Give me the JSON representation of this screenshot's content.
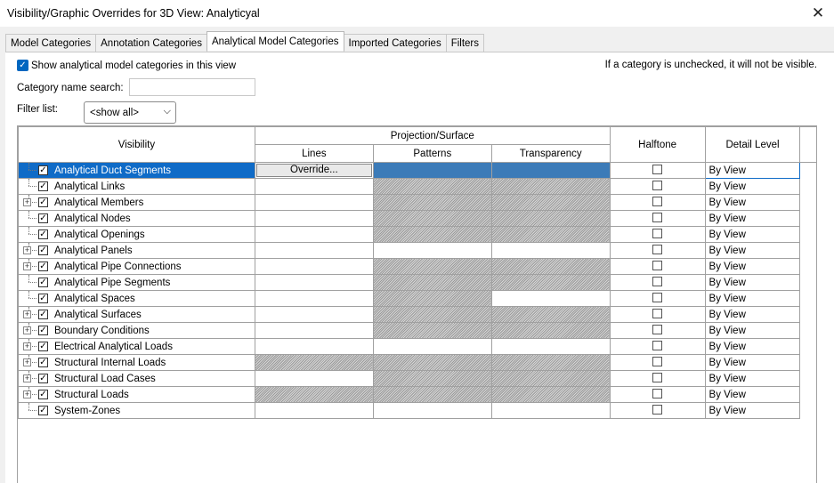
{
  "window": {
    "title": "Visibility/Graphic Overrides for 3D View: Analyticyal"
  },
  "tabs": [
    "Model Categories",
    "Annotation Categories",
    "Analytical Model Categories",
    "Imported Categories",
    "Filters"
  ],
  "active_tab": "Analytical Model Categories",
  "show_categories": {
    "label": "Show analytical model categories in this view",
    "checked": true
  },
  "note": "If a category is unchecked, it will not be visible.",
  "search": {
    "label": "Category name search:",
    "value": ""
  },
  "filter": {
    "label": "Filter list:",
    "value": "<show all>"
  },
  "grid": {
    "headers": {
      "visibility": "Visibility",
      "projection": "Projection/Surface",
      "lines": "Lines",
      "patterns": "Patterns",
      "transparency": "Transparency",
      "halftone": "Halftone",
      "detail": "Detail Level"
    },
    "override_label": "Override...",
    "rows": [
      {
        "name": "Analytical Duct Segments",
        "expandable": false,
        "lines": "override",
        "patterns": "plain",
        "transparency": "plain",
        "detail": "By View",
        "selected": true
      },
      {
        "name": "Analytical Links",
        "expandable": false,
        "lines": "plain",
        "patterns": "hatch",
        "transparency": "hatch",
        "detail": "By View"
      },
      {
        "name": "Analytical Members",
        "expandable": true,
        "lines": "plain",
        "patterns": "hatch",
        "transparency": "hatch",
        "detail": "By View"
      },
      {
        "name": "Analytical Nodes",
        "expandable": false,
        "lines": "plain",
        "patterns": "hatch",
        "transparency": "hatch",
        "detail": "By View"
      },
      {
        "name": "Analytical Openings",
        "expandable": false,
        "lines": "plain",
        "patterns": "hatch",
        "transparency": "hatch",
        "detail": "By View"
      },
      {
        "name": "Analytical Panels",
        "expandable": true,
        "lines": "plain",
        "patterns": "plain",
        "transparency": "plain",
        "detail": "By View"
      },
      {
        "name": "Analytical Pipe Connections",
        "expandable": true,
        "lines": "plain",
        "patterns": "hatch",
        "transparency": "hatch",
        "detail": "By View"
      },
      {
        "name": "Analytical Pipe Segments",
        "expandable": false,
        "lines": "plain",
        "patterns": "hatch",
        "transparency": "hatch",
        "detail": "By View"
      },
      {
        "name": "Analytical Spaces",
        "expandable": false,
        "lines": "plain",
        "patterns": "hatch",
        "transparency": "plain",
        "detail": "By View"
      },
      {
        "name": "Analytical Surfaces",
        "expandable": true,
        "lines": "plain",
        "patterns": "hatch",
        "transparency": "hatch",
        "detail": "By View"
      },
      {
        "name": "Boundary Conditions",
        "expandable": true,
        "lines": "plain",
        "patterns": "hatch",
        "transparency": "hatch",
        "detail": "By View"
      },
      {
        "name": "Electrical Analytical Loads",
        "expandable": true,
        "lines": "plain",
        "patterns": "plain",
        "transparency": "plain",
        "detail": "By View"
      },
      {
        "name": "Structural Internal Loads",
        "expandable": true,
        "lines": "hatch",
        "patterns": "hatch",
        "transparency": "hatch",
        "detail": "By View"
      },
      {
        "name": "Structural Load Cases",
        "expandable": true,
        "lines": "plain",
        "patterns": "hatch",
        "transparency": "hatch",
        "detail": "By View"
      },
      {
        "name": "Structural Loads",
        "expandable": true,
        "lines": "hatch",
        "patterns": "hatch",
        "transparency": "hatch",
        "detail": "By View"
      },
      {
        "name": "System-Zones",
        "expandable": false,
        "lines": "plain",
        "patterns": "plain",
        "transparency": "plain",
        "detail": "By View"
      }
    ]
  },
  "colors": {
    "selection": "#0f6bc7",
    "checkbox_accent": "#0067c0"
  },
  "icons": {
    "close": "close-icon",
    "check": "checkmark-icon",
    "expand": "plus-expand-icon",
    "dropdown": "chevron-down-icon"
  }
}
